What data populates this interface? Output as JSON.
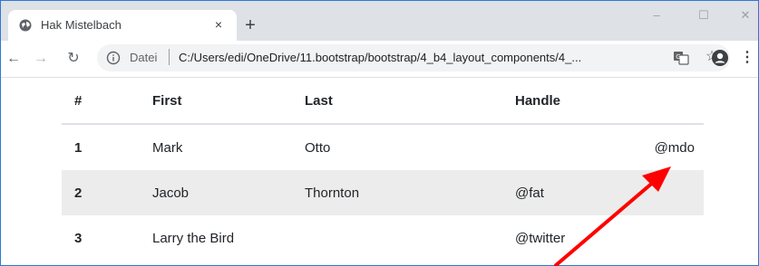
{
  "browser": {
    "tab_title": "Hak Mistelbach",
    "tab_close": "×",
    "new_tab": "+",
    "window_controls": {
      "minimize": "–",
      "maximize": "☐",
      "close": "✕"
    },
    "nav": {
      "back": "←",
      "forward": "→",
      "reload": "↻"
    },
    "address": {
      "scheme_label": "Datei",
      "url": "C:/Users/edi/OneDrive/11.bootstrap/bootstrap/4_b4_layout_components/4_..."
    },
    "icons": {
      "favicon": "globe-icon",
      "info": "info-icon",
      "translate": "translate-icon",
      "bookmark": "star-icon",
      "account": "account-icon",
      "menu": "more-vert-icon"
    },
    "star": "☆",
    "menu": "⋮"
  },
  "table": {
    "headers": [
      "#",
      "First",
      "Last",
      "Handle"
    ],
    "rows": [
      {
        "num": "1",
        "first": "Mark",
        "last": "Otto",
        "handle": "@mdo",
        "handle_align": "right"
      },
      {
        "num": "2",
        "first": "Jacob",
        "last": "Thornton",
        "handle": "@fat"
      },
      {
        "num": "3",
        "first": "Larry the Bird",
        "last": "",
        "handle": "@twitter"
      }
    ],
    "striped_row_color": "#ececec"
  },
  "annotation": {
    "arrow_color": "#ff0000",
    "target": "@mdo"
  }
}
